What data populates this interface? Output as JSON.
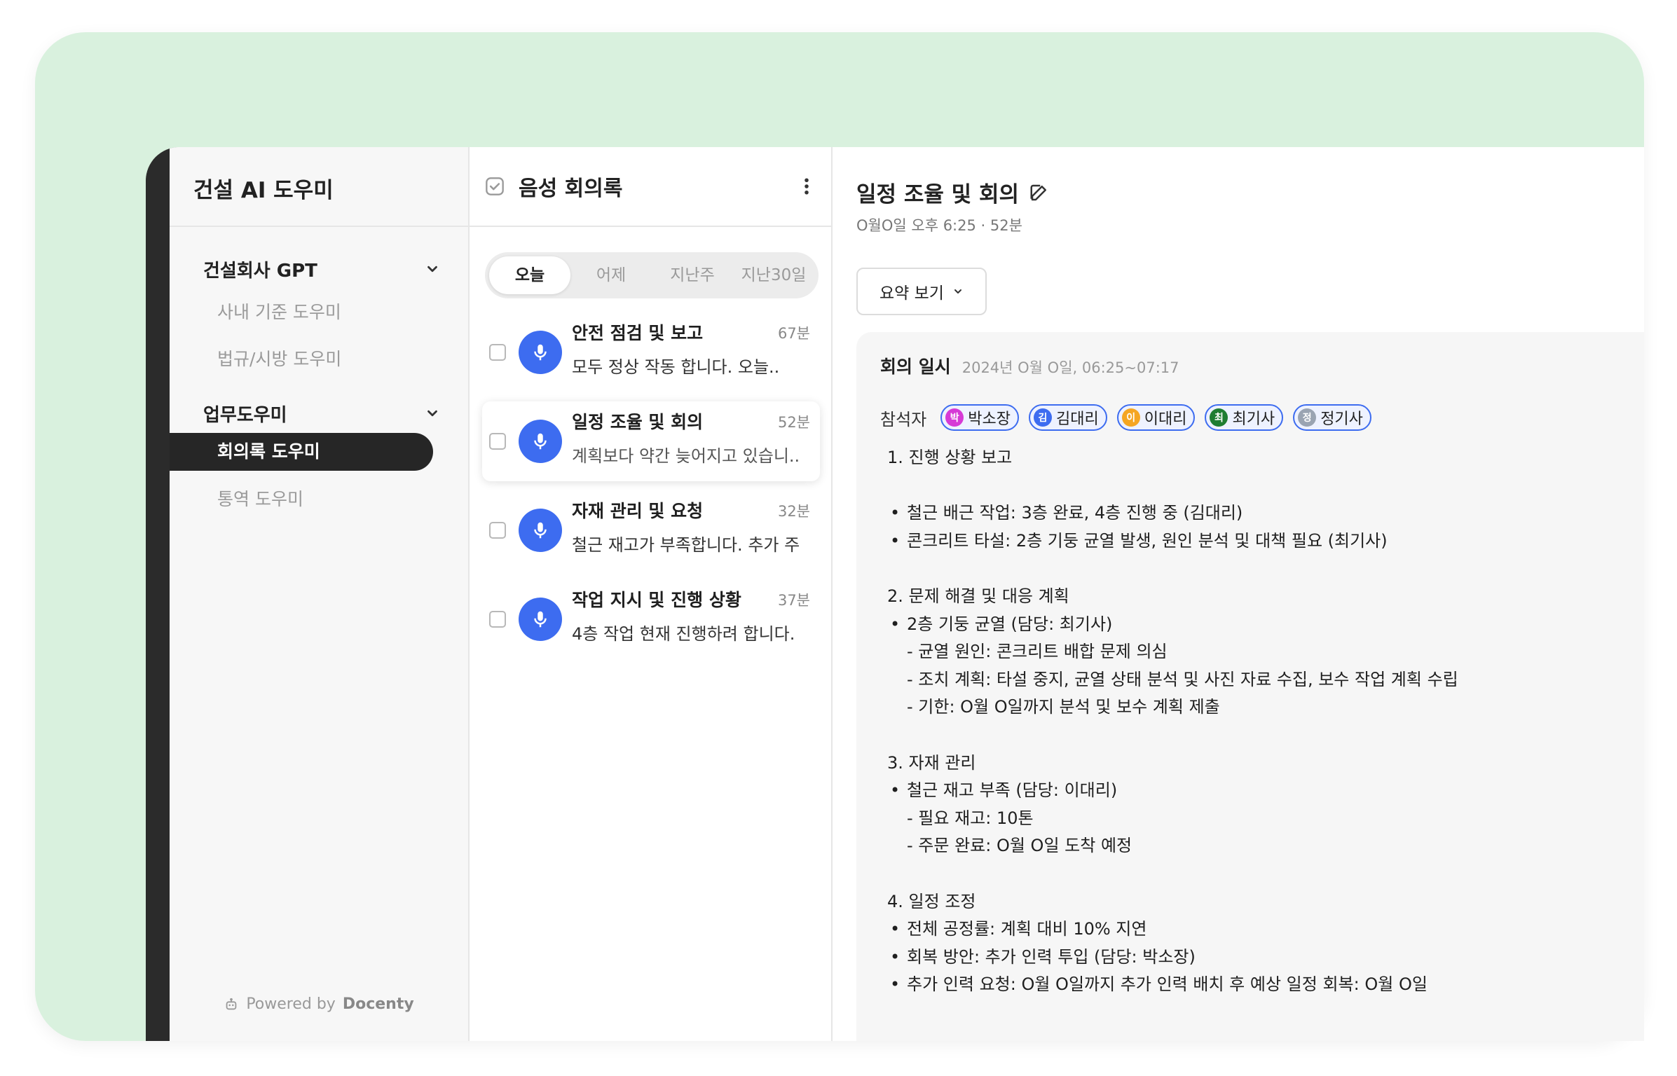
{
  "sidebar": {
    "brand": "건설 AI 도우미",
    "groups": [
      {
        "title": "건설회사 GPT",
        "items": [
          "사내 기준 도우미",
          "법규/시방 도우미"
        ]
      },
      {
        "title": "업무도우미",
        "items": [
          "회의록 도우미",
          "통역 도우미"
        ],
        "active_index": 0
      }
    ],
    "powered_prefix": "Powered by",
    "powered_brand": "Docenty"
  },
  "list": {
    "title": "음성 회의록",
    "tabs": [
      "오늘",
      "어제",
      "지난주",
      "지난30일"
    ],
    "active_tab": "오늘",
    "items": [
      {
        "title": "안전 점검 및 보고",
        "duration": "67분",
        "preview": "모두 정상 작동 합니다. 오늘..",
        "selected": false
      },
      {
        "title": "일정 조율 및 회의",
        "duration": "52분",
        "preview": "계획보다 약간 늦어지고 있습니..",
        "selected": true
      },
      {
        "title": "자재 관리 및 요청",
        "duration": "32분",
        "preview": "철근 재고가 부족합니다. 추가 주",
        "selected": false
      },
      {
        "title": "작업 지시 및 진행 상황",
        "duration": "37분",
        "preview": "4층 작업 현재 진행하려 합니다.",
        "selected": false
      }
    ]
  },
  "detail": {
    "title": "일정 조율 및 회의",
    "meta": "O월O일 오후 6:25 · 52분",
    "summary_button": "요약 보기",
    "meeting_date_label": "회의 일시",
    "meeting_date": "2024년 O월 O일, 06:25~07:17",
    "participants_label": "참석자",
    "participants": [
      {
        "initial": "박",
        "name": "박소장",
        "color": "#d63ad6"
      },
      {
        "initial": "김",
        "name": "김대리",
        "color": "#3d6cf0"
      },
      {
        "initial": "이",
        "name": "이대리",
        "color": "#f5a623"
      },
      {
        "initial": "최",
        "name": "최기사",
        "color": "#1e7d32"
      },
      {
        "initial": "정",
        "name": "정기사",
        "color": "#9aa4b2"
      }
    ],
    "notes": [
      {
        "type": "h",
        "text": "1. 진행 상황 보고"
      },
      {
        "type": "sp",
        "text": ""
      },
      {
        "type": "b",
        "text": "철근 배근 작업: 3층 완료, 4층 진행 중 (김대리)"
      },
      {
        "type": "b",
        "text": "콘크리트 타설: 2층 기둥 균열 발생, 원인 분석 및 대책 필요 (최기사)"
      },
      {
        "type": "sp",
        "text": ""
      },
      {
        "type": "h",
        "text": "2. 문제 해결 및 대응 계획"
      },
      {
        "type": "b",
        "text": "2층 기둥 균열 (담당: 최기사)"
      },
      {
        "type": "d",
        "text": "- 균열 원인: 콘크리트 배합 문제 의심"
      },
      {
        "type": "d",
        "text": "- 조치 계획: 타설 중지, 균열 상태 분석 및 사진 자료 수집, 보수 작업 계획 수립"
      },
      {
        "type": "d",
        "text": "- 기한: O월 O일까지 분석 및 보수 계획 제출"
      },
      {
        "type": "sp",
        "text": ""
      },
      {
        "type": "h",
        "text": "3. 자재 관리"
      },
      {
        "type": "b",
        "text": "철근 재고 부족 (담당: 이대리)"
      },
      {
        "type": "d",
        "text": "- 필요 재고: 10톤"
      },
      {
        "type": "d",
        "text": "- 주문 완료: O월 O일 도착 예정"
      },
      {
        "type": "sp",
        "text": ""
      },
      {
        "type": "h",
        "text": "4. 일정 조정"
      },
      {
        "type": "b",
        "text": "전체 공정률: 계획 대비 10% 지연"
      },
      {
        "type": "b",
        "text": "회복 방안: 추가 인력 투입 (담당: 박소장)"
      },
      {
        "type": "b",
        "text": "추가 인력 요청: O월 O일까지 추가 인력 배치 후 예상 일정 회복: O월 O일"
      }
    ]
  },
  "colors": {
    "accent": "#3d6cf0",
    "background_mint": "#d9f1de",
    "sidebar_active": "#262626"
  }
}
